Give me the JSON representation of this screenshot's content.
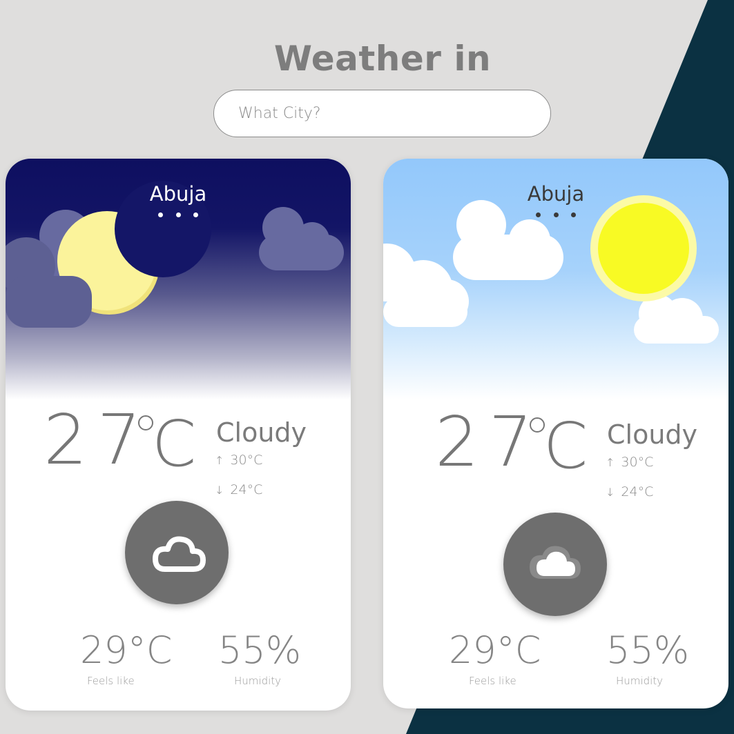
{
  "header": {
    "title": "Weather in"
  },
  "search": {
    "placeholder": "What City?",
    "value": ""
  },
  "colors": {
    "page_background": "#dfdedd",
    "accent_stripe": "#0b3142",
    "night_sky": "#0e0f60",
    "day_sky": "#93c8fb",
    "moon": "#fdf399",
    "sun": "#f8fa24",
    "icon_circle": "#6e6e6e"
  },
  "cards": [
    {
      "theme": "night",
      "city": "Abuja",
      "temperature": "27",
      "unit": "C",
      "condition": "Cloudy",
      "high": "30°C",
      "low": "24°C",
      "feels_like_value": "29°C",
      "feels_like_label": "Feels like",
      "humidity_value": "55%",
      "humidity_label": "Humidity",
      "condition_icon": "cloud-icon"
    },
    {
      "theme": "day",
      "city": "Abuja",
      "temperature": "27",
      "unit": "C",
      "condition": "Cloudy",
      "high": "30°C",
      "low": "24°C",
      "feels_like_value": "29°C",
      "feels_like_label": "Feels like",
      "humidity_value": "55%",
      "humidity_label": "Humidity",
      "condition_icon": "cloud-icon"
    }
  ]
}
